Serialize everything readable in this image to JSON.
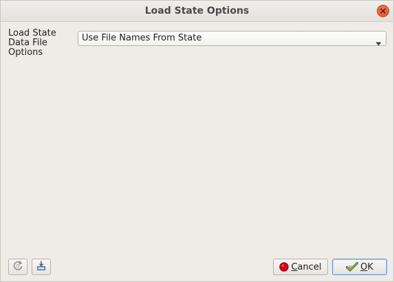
{
  "window": {
    "title": "Load State Options"
  },
  "form": {
    "label": "Load State Data File Options",
    "select_value": "Use File Names From State"
  },
  "footer": {
    "cancel_label": "Cancel",
    "ok_label": "OK"
  },
  "icons": {
    "close": "close-icon",
    "dropdown": "chevron-down-icon",
    "reset": "reset-icon",
    "save_default": "save-default-icon",
    "cancel": "stop-icon",
    "ok": "check-icon"
  },
  "colors": {
    "close_button": "#e0542a",
    "cancel_icon": "#d0021b",
    "ok_border": "#6a98c7"
  }
}
